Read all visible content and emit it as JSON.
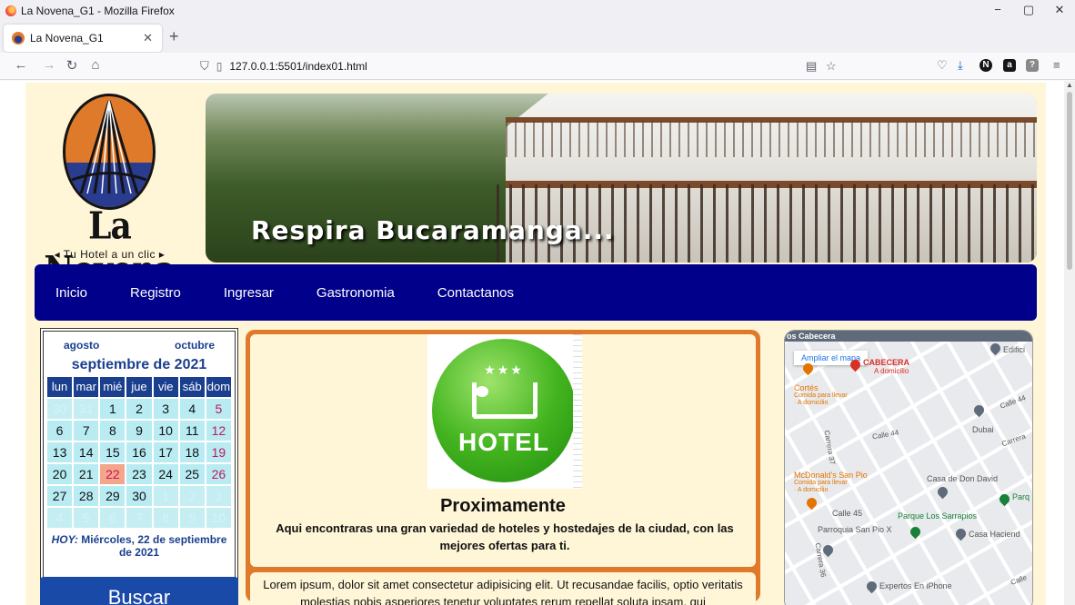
{
  "browser": {
    "window_title": "La Novena_G1 - Mozilla Firefox",
    "tab_title": "La Novena_G1",
    "url": "127.0.0.1:5501/index01.html",
    "window_controls": [
      "−",
      "▢",
      "✕"
    ]
  },
  "site": {
    "brand": "La Novena",
    "tagline": "◂ Tu Hotel a un clic ▸",
    "banner_text": "Respira Bucaramanga...",
    "menu": [
      "Inicio",
      "Registro",
      "Ingresar",
      "Gastronomia",
      "Contactanos"
    ]
  },
  "calendar": {
    "prev_month": "agosto",
    "next_month": "octubre",
    "title": "septiembre de 2021",
    "weekdays": [
      "lun",
      "mar",
      "mié",
      "jue",
      "vie",
      "sáb",
      "dom"
    ],
    "days": [
      [
        "30",
        "31",
        "1",
        "2",
        "3",
        "4",
        "5"
      ],
      [
        "6",
        "7",
        "8",
        "9",
        "10",
        "11",
        "12"
      ],
      [
        "13",
        "14",
        "15",
        "16",
        "17",
        "18",
        "19"
      ],
      [
        "20",
        "21",
        "22",
        "23",
        "24",
        "25",
        "26"
      ],
      [
        "27",
        "28",
        "29",
        "30",
        "1",
        "2",
        "3"
      ],
      [
        "4",
        "5",
        "6",
        "7",
        "8",
        "9",
        "10"
      ]
    ],
    "today_label": "HOY:",
    "today_text": "Miércoles, 22 de septiembre de 2021",
    "search_button": "Buscar"
  },
  "main": {
    "hotel_icon_text": "HOTEL",
    "title": "Proximamente",
    "subtitle": "Aqui encontraras una gran variedad de hoteles y hostedajes de la ciudad, con las mejores ofertas para ti.",
    "lorem": "Lorem ipsum, dolor sit amet consectetur adipisicing elit. Ut recusandae facilis, optio veritatis molestias nobis asperiores tenetur voluptates rerum repellat soluta ipsam, qui"
  },
  "map": {
    "ampliar": "Ampliar el mapa",
    "labels": {
      "cabecera_top": "os Cabecera",
      "cabecera": "CABECERA",
      "a_domicilio": "A domicilio",
      "edificio": "Edifici",
      "cortes": "Cortés",
      "comida_llevar": "Comida para llevar",
      "a_domicilio2": "· A domicilio",
      "calle44": "Calle 44",
      "calle44b": "Calle 44",
      "dubai": "Dubai",
      "carrera": "Carrera",
      "carrera37": "Carrera 37",
      "mcdonalds": "McDonald's San Pio",
      "comida_llevar2": "Comida para llevar",
      "a_domicilio3": "· A domicilio",
      "casa_don_david": "Casa de Don David",
      "parq_enri": "Parq Enri",
      "calle45": "Calle 45",
      "parque_sarrapios": "Parque Los Sarrapios",
      "parroquia": "Parroquia San Pio X",
      "casa_hacienda": "Casa Haciend",
      "carrera36": "Carrera 36",
      "expertos": "Expertos En iPhone",
      "calle": "Calle"
    }
  },
  "colors": {
    "page_bg": "#fff5d7",
    "nav_blue": "#00008b",
    "accent_orange": "#e07a2b",
    "calendar_blue": "#1a3f8f",
    "calendar_cell": "#b8ecf2",
    "today_cell": "#f4a58a"
  }
}
